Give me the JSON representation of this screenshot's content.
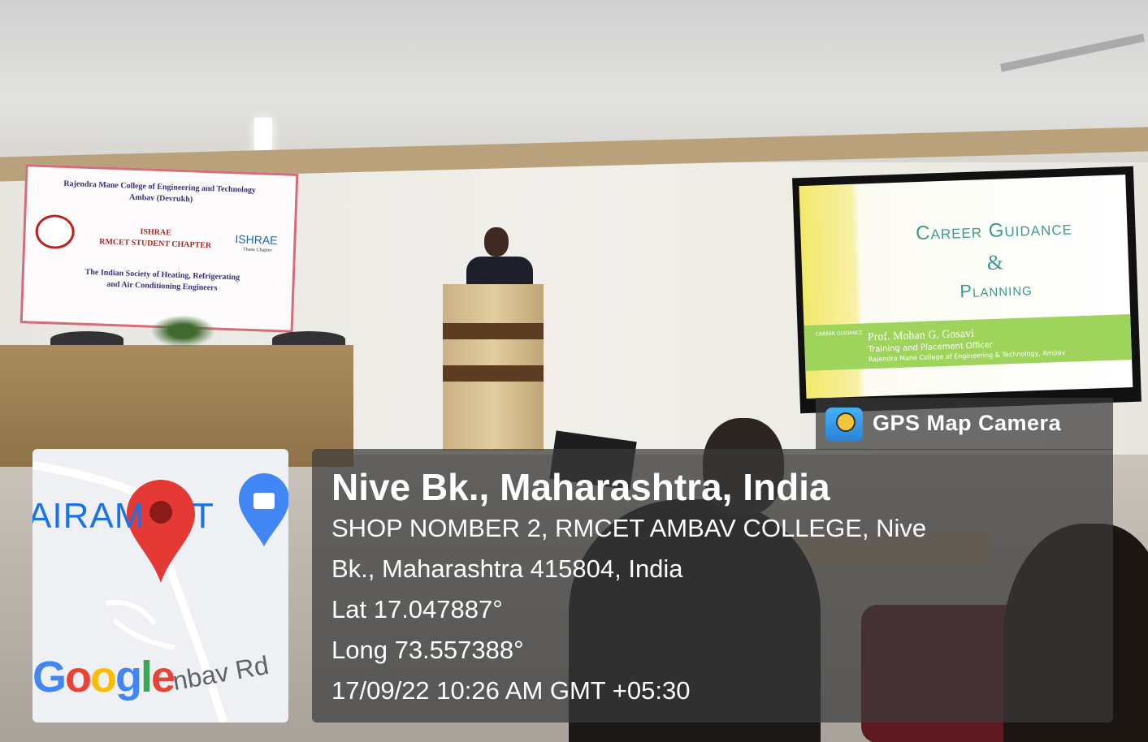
{
  "banner": {
    "college": "Rajendra Mane College of Engineering and Technology",
    "place": "Ambav (Devrukh)",
    "org": "ISHRAE",
    "chapter": "RMCET STUDENT CHAPTER",
    "logo_text": "ISHRAE",
    "logo_sub": "Thane Chapter",
    "society_line1": "The Indian Society of Heating, Refrigerating",
    "society_line2": "and Air Conditioning Engineers"
  },
  "slide": {
    "title_line1": "Career Guidance",
    "title_line2": "&",
    "title_line3": "Planning",
    "side_label": "CAREER GUIDANCE",
    "speaker": "Prof. Mohan G. Gosavi",
    "role": "Training and Placement Officer",
    "institution": "Rajendra Mane College of Engineering & Technology, Ambav"
  },
  "gps_tag": {
    "label": "GPS Map Camera",
    "icon": "gps-map-camera-icon"
  },
  "location": {
    "place": "Nive Bk., Maharashtra, India",
    "address_line1": "SHOP NOMBER 2, RMCET AMBAV COLLEGE, Nive",
    "address_line2": "Bk., Maharashtra 415804, India",
    "lat": "Lat 17.047887°",
    "long": "Long 73.557388°",
    "datetime": "17/09/22 10:26 AM GMT +05:30"
  },
  "map": {
    "poi_left": "AIRAM",
    "poi_right": "T",
    "road": "nbav Rd",
    "brand": [
      "G",
      "o",
      "o",
      "g",
      "l",
      "e"
    ],
    "brand_colors": [
      "#4285F4",
      "#EA4335",
      "#FBBC05",
      "#4285F4",
      "#34A853",
      "#EA4335"
    ],
    "pin_color": "#E53935",
    "shop_pin_color": "#4285F4"
  }
}
